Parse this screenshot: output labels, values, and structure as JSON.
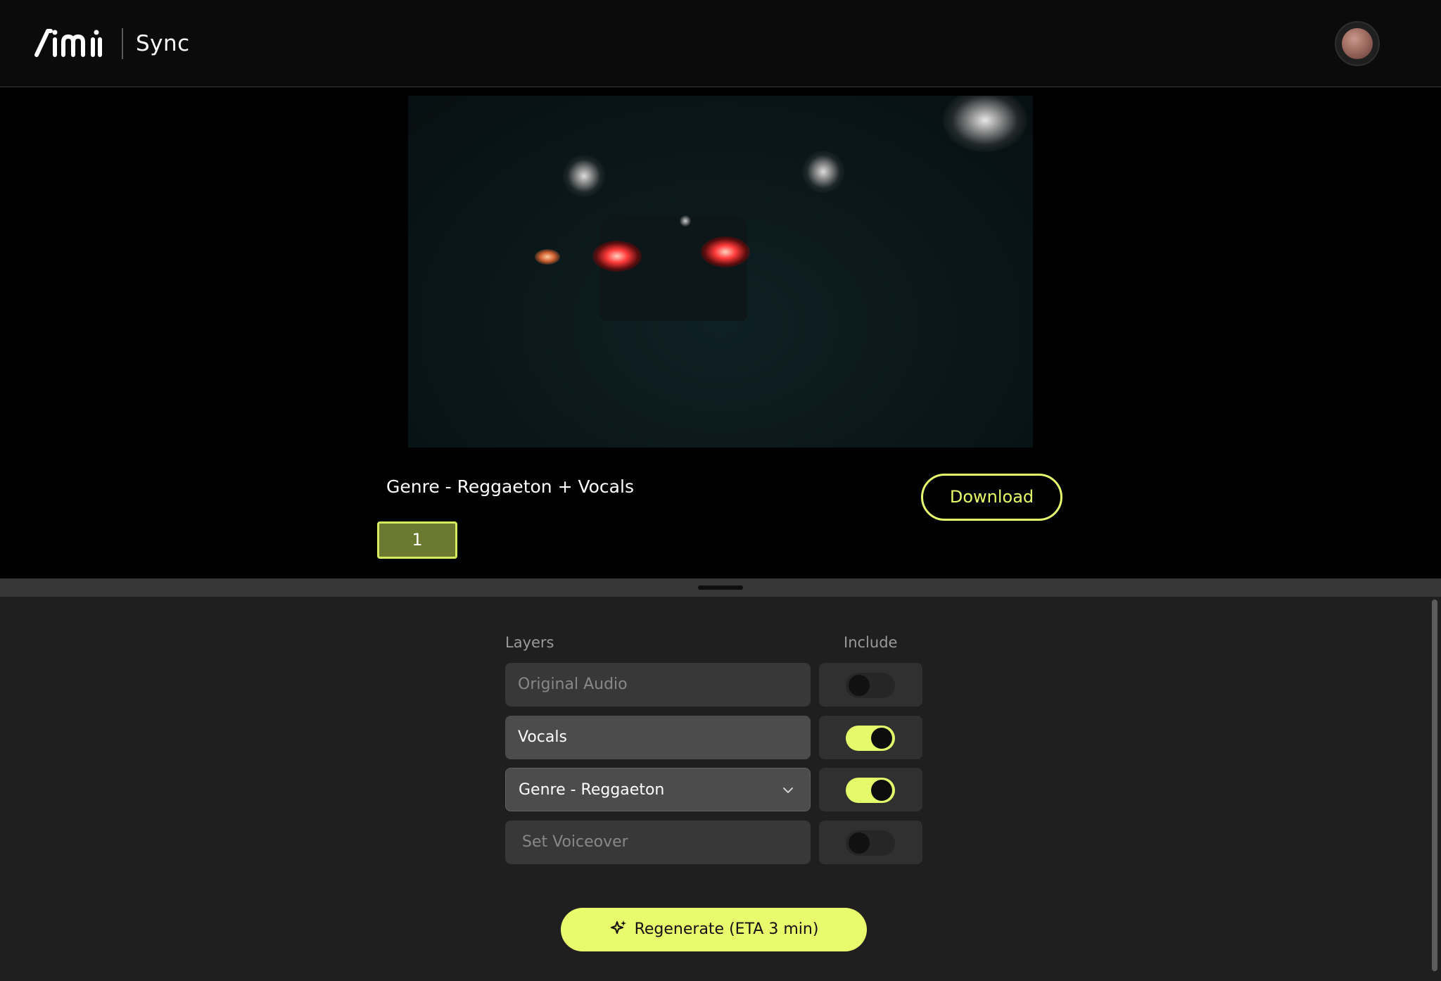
{
  "app": {
    "product_name": "Sync"
  },
  "player": {
    "track_title": "Genre - Reggaeton + Vocals",
    "download_label": "Download",
    "version_tabs": [
      "1"
    ]
  },
  "layers": {
    "header_layers": "Layers",
    "header_include": "Include",
    "rows": [
      {
        "label": "Original Audio",
        "included": false
      },
      {
        "label": "Vocals",
        "included": true
      },
      {
        "label": "Genre - Reggaeton",
        "included": true,
        "type": "dropdown"
      },
      {
        "label": "Set Voiceover",
        "included": false
      }
    ]
  },
  "actions": {
    "regenerate_label": "Regenerate (ETA 3 min)"
  },
  "colors": {
    "accent": "#e8fb6c",
    "panel_bg": "#1f1f1f",
    "header_bg": "#0b0b0b"
  },
  "icons": {
    "logo": "aimi-logo",
    "dropdown": "chevron-down-icon",
    "regenerate": "sparkle-icon"
  }
}
